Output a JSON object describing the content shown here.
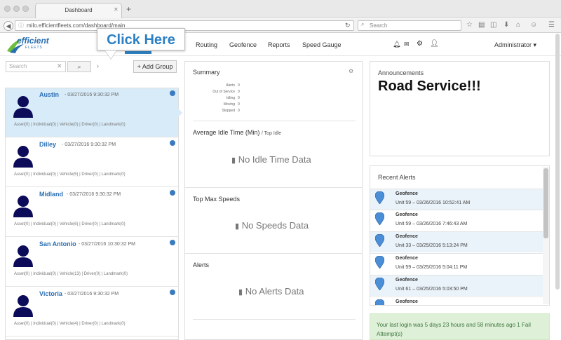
{
  "browser": {
    "tab_title": "Dashboard",
    "new_tab": "+",
    "url": "milo.efficientfleets.com/dashboard/main",
    "search_placeholder": "Search"
  },
  "app": {
    "logo_text": "efficient",
    "logo_sub": "FLEETS",
    "callout": "Click Here",
    "nav": [
      "Routing",
      "Geofence",
      "Reports",
      "Speed Gauge"
    ],
    "user_name": "Administrator ▾"
  },
  "left": {
    "search_placeholder": "Search",
    "add_group_label": "Add Group",
    "units": [
      {
        "name": "Austin",
        "date": "- 03/27/2016 9:30:32 PM",
        "counts": "Asset(0) | Individual(0) | Vehicle(0) | Driver(0) | Landmark(0)"
      },
      {
        "name": "Dilley",
        "date": "- 03/27/2016 9:30:32 PM",
        "counts": "Asset(0) | Individual(0) | Vehicle(5) | Driver(0) | Landmark(0)"
      },
      {
        "name": "Midland",
        "date": "- 03/27/2016 9:30:32 PM",
        "counts": "Asset(0) | Individual(0) | Vehicle(6) | Driver(0) | Landmark(0)"
      },
      {
        "name": "San Antonio",
        "date": "- 03/27/2016 10:30:32 PM",
        "counts": "Asset(0) | Individual(0) | Vehicle(13) | Driver(0) | Landmark(0)"
      },
      {
        "name": "Victoria",
        "date": "- 03/27/2016 9:30:32 PM",
        "counts": "Asset(0) | Individual(0) | Vehicle(4) | Driver(0) | Landmark(0)"
      }
    ]
  },
  "summary": {
    "title": "Summary",
    "rows": [
      {
        "label": "Alerts",
        "value": "0"
      },
      {
        "label": "Out of Service",
        "value": "0"
      },
      {
        "label": "Idling",
        "value": "0"
      },
      {
        "label": "Moving",
        "value": "0"
      },
      {
        "label": "Stopped",
        "value": "0"
      }
    ],
    "idle_title": "Average Idle Time (Min)",
    "idle_sub": "/ Top Idle",
    "idle_empty": "No Idle Time Data",
    "speeds_title": "Top Max Speeds",
    "speeds_empty": "No Speeds Data",
    "alerts_title": "Alerts",
    "alerts_empty": "No Alerts Data"
  },
  "announcements": {
    "label": "Announcements",
    "text": "Road Service!!!"
  },
  "recent_alerts": {
    "title": "Recent Alerts",
    "items": [
      {
        "type": "Geofence",
        "detail": "Unit 59 – 03/26/2016 10:52:41 AM"
      },
      {
        "type": "Geofence",
        "detail": "Unit 59 – 03/26/2016 7:46:43 AM"
      },
      {
        "type": "Geofence",
        "detail": "Unit 33 – 03/25/2016 5:13:24 PM"
      },
      {
        "type": "Geofence",
        "detail": "Unit 59 – 03/25/2016 5:04:11 PM"
      },
      {
        "type": "Geofence",
        "detail": "Unit 61 – 03/25/2016 5:03:50 PM"
      },
      {
        "type": "Geofence",
        "detail": ""
      }
    ]
  },
  "login_message": "Your last login was 5 days 23 hours and 58 minutes ago 1 Fail Attempt(s)",
  "colors": {
    "accent": "#2f7fc1",
    "selected_row": "#d7ebf8",
    "success_bg": "#dff0d8",
    "pin": "#4a8ed8"
  }
}
